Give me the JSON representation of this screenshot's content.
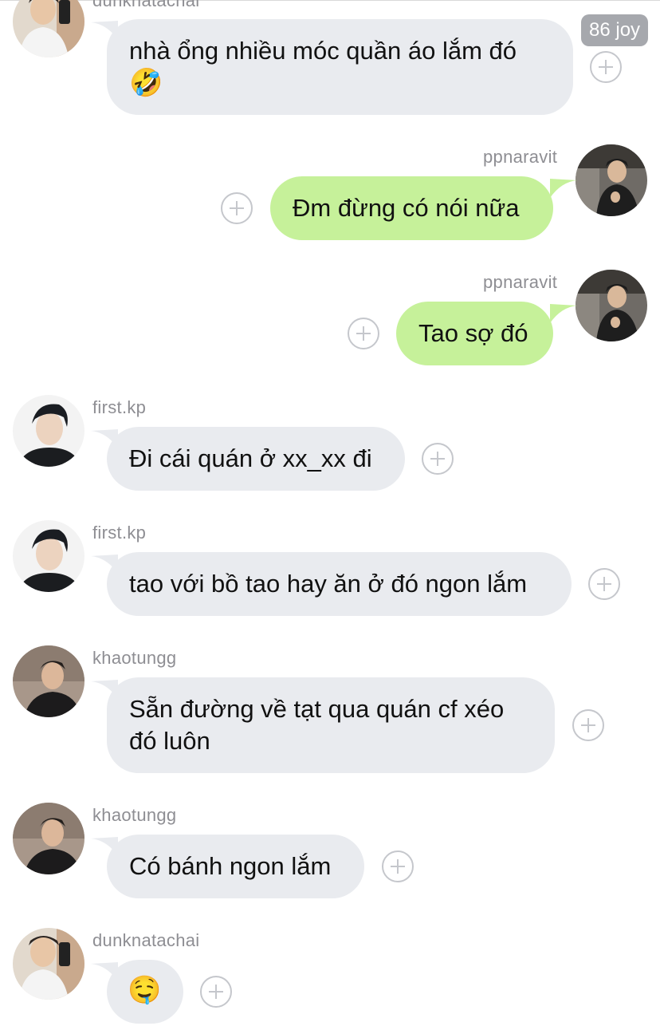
{
  "messages": [
    {
      "user": "dunknatachai",
      "text": "nhà ổng nhiều móc quần áo lắm đó",
      "emoji": "🤣",
      "side": "in",
      "avatar": "dunk"
    },
    {
      "user": "ppnaravit",
      "text": "Đm đừng có nói nữa",
      "side": "out",
      "avatar": "pp"
    },
    {
      "user": "ppnaravit",
      "text": "Tao sợ đó",
      "side": "out",
      "avatar": "pp"
    },
    {
      "user": "first.kp",
      "text": "Đi cái quán ở xx_xx đi",
      "side": "in",
      "avatar": "first"
    },
    {
      "user": "first.kp",
      "text": "tao với bồ tao hay ăn ở đó ngon lắm",
      "side": "in",
      "avatar": "first"
    },
    {
      "user": "khaotungg",
      "text": "Sẵn đường về tạt qua quán cf xéo đó luôn",
      "side": "in",
      "avatar": "khao"
    },
    {
      "user": "khaotungg",
      "text": "Có bánh ngon lắm",
      "side": "in",
      "avatar": "khao"
    },
    {
      "user": "dunknatachai",
      "text": "",
      "emoji": "🤤",
      "side": "in",
      "avatar": "dunk"
    }
  ],
  "badge": {
    "joy": "86 joy"
  },
  "icons": {
    "add_reaction": "plus-circle-icon"
  },
  "colors": {
    "incoming_bubble": "#e9ebef",
    "outgoing_bubble": "#c6f19a",
    "username": "#8e8e93"
  }
}
